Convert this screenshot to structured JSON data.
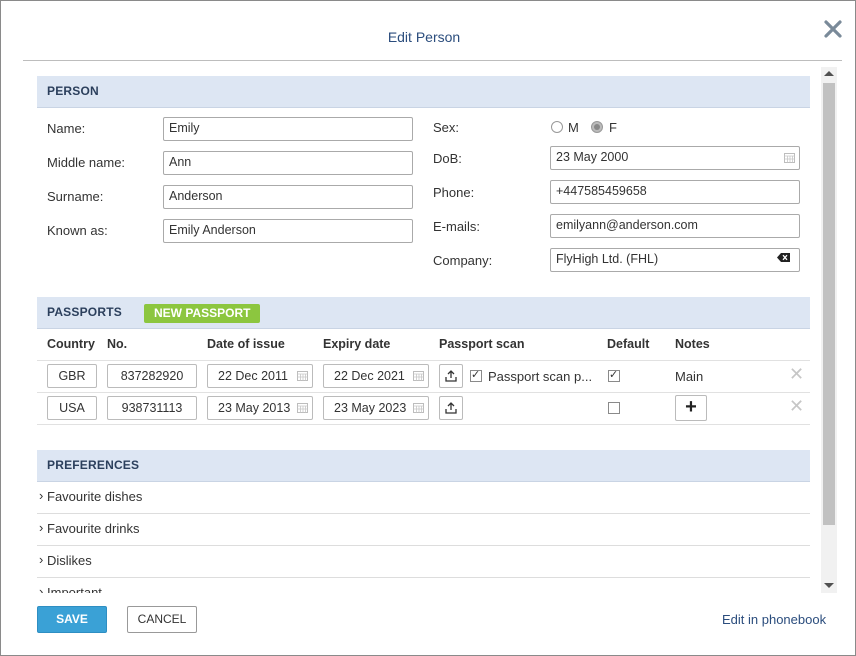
{
  "dialog": {
    "title": "Edit Person"
  },
  "person": {
    "section_label": "PERSON",
    "name_label": "Name:",
    "name_value": "Emily",
    "middle_label": "Middle name:",
    "middle_value": "Ann",
    "surname_label": "Surname:",
    "surname_value": "Anderson",
    "known_label": "Known as:",
    "known_value": "Emily Anderson",
    "sex_label": "Sex:",
    "sex_m": "M",
    "sex_f": "F",
    "sex_selected": "F",
    "dob_label": "DoB:",
    "dob_value": "23 May 2000",
    "phone_label": "Phone:",
    "phone_value": "+447585459658",
    "emails_label": "E-mails:",
    "emails_value": "emilyann@anderson.com",
    "company_label": "Company:",
    "company_value": "FlyHigh Ltd. (FHL)"
  },
  "passports": {
    "section_label": "PASSPORTS",
    "new_button": "NEW PASSPORT",
    "columns": [
      "Country",
      "No.",
      "Date of issue",
      "Expiry date",
      "Passport scan",
      "Default",
      "Notes"
    ],
    "rows": [
      {
        "country": "GBR",
        "number": "837282920",
        "issue": "22 Dec 2011",
        "expiry": "22 Dec 2021",
        "scan_checked": true,
        "scan_label": "Passport scan p...",
        "default": true,
        "notes": "Main"
      },
      {
        "country": "USA",
        "number": "938731113",
        "issue": "23 May 2013",
        "expiry": "23 May 2023",
        "scan_checked": false,
        "scan_label": "",
        "default": false,
        "notes": ""
      }
    ]
  },
  "preferences": {
    "section_label": "PREFERENCES",
    "items": [
      "Favourite dishes",
      "Favourite drinks",
      "Dislikes",
      "Important"
    ]
  },
  "footer": {
    "save": "SAVE",
    "cancel": "CANCEL",
    "phonebook_link": "Edit in phonebook"
  },
  "icons": {
    "close": "close-icon",
    "calendar": "calendar-icon",
    "clear": "backspace-icon",
    "upload": "upload-icon",
    "delete": "delete-x-icon",
    "chevron": "chevron-right-icon",
    "plus": "plus-icon"
  },
  "colors": {
    "accent": "#3aa1d6",
    "section_bg": "#dde6f3",
    "new_passport": "#8cc63f",
    "title": "#2b4d7d"
  }
}
